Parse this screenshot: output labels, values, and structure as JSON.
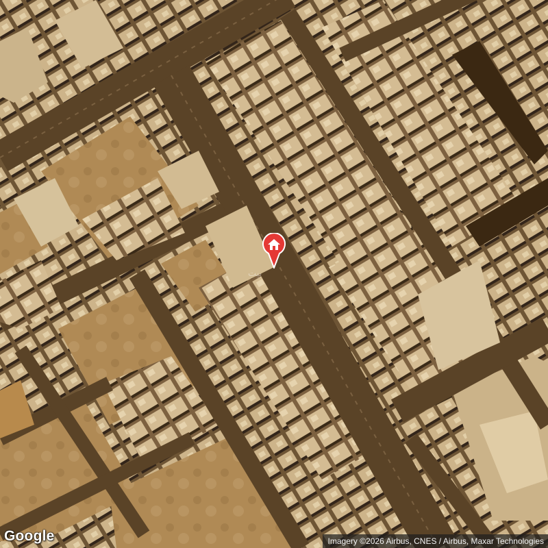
{
  "map": {
    "type": "satellite",
    "marker": {
      "icon": "home-icon",
      "color": "#e53935"
    },
    "logo_text": "Google",
    "attribution": "Imagery ©2026 Airbus, CNES / Airbus, Maxar Technologies",
    "colors": {
      "road": "#4a3922",
      "sand": "#b8935a",
      "roof": "#d9c4a0",
      "shadow": "#2b1f12"
    }
  }
}
